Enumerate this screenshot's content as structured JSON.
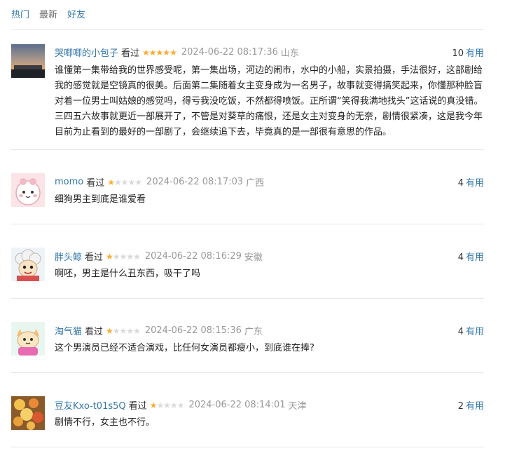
{
  "tabs": [
    "热门",
    "最新",
    "好友"
  ],
  "colors": {
    "link": "#3377aa",
    "star": "#ffac2d",
    "meta": "#999999"
  },
  "reviews": [
    {
      "user": "哭唧唧的小包子",
      "status": "看过",
      "rating": 5,
      "time": "2024-06-22 08:17:36",
      "location": "山东",
      "useful_count": "10",
      "useful_label": "有用",
      "avatar": "sunset-photo-avatar",
      "text": "谁懂第一集带给我的世界感受呢，第一集出场，河边的闹市，水中的小船，实景拍摄，手法很好，这部剧给我的感觉就是空镜真的很美。后面第二集随着女主变身成为一名男子，故事就变得搞笑起来，你懂那种脸盲对着一位男士叫姑娘的感觉吗，得亏我没吃饭，不然都得喷饭。正所谓“笑得我满地找头”这话说的真没错。三四五六故事就更近一部展开了，不管是对葵草的痛恨，还是女主对变身的无奈，剧情很紧凑，这是我今年目前为止看到的最好的一部剧了，会继续追下去，毕竟真的是一部很有意思的作品。"
    },
    {
      "user": "momo",
      "status": "看过",
      "rating": 1,
      "time": "2024-06-22 08:17:03",
      "location": "广西",
      "useful_count": "4",
      "useful_label": "有用",
      "avatar": "pink-cartoon-avatar",
      "text": "细狗男主到底是谁爱看"
    },
    {
      "user": "胖头鲸",
      "status": "看过",
      "rating": 1,
      "time": "2024-06-22 08:16:29",
      "location": "安徽",
      "useful_count": "4",
      "useful_label": "有用",
      "avatar": "cartoon-sheep-avatar",
      "text": "啊呸，男主是什么丑东西，吸干了吗"
    },
    {
      "user": "淘气猫",
      "status": "看过",
      "rating": 1,
      "time": "2024-06-22 08:15:36",
      "location": "广东",
      "useful_count": "4",
      "useful_label": "有用",
      "avatar": "cartoon-cat-avatar",
      "text": "这个男演员已经不适合演戏，比任何女演员都瘦小，到底谁在捧?"
    },
    {
      "user": "豆友Kxo-t01s5Q",
      "status": "看过",
      "rating": 1,
      "time": "2024-06-22 08:14:01",
      "location": "天津",
      "useful_count": "2",
      "useful_label": "有用",
      "avatar": "flower-photo-avatar",
      "text": "剧情不行，女主也不行。"
    }
  ]
}
